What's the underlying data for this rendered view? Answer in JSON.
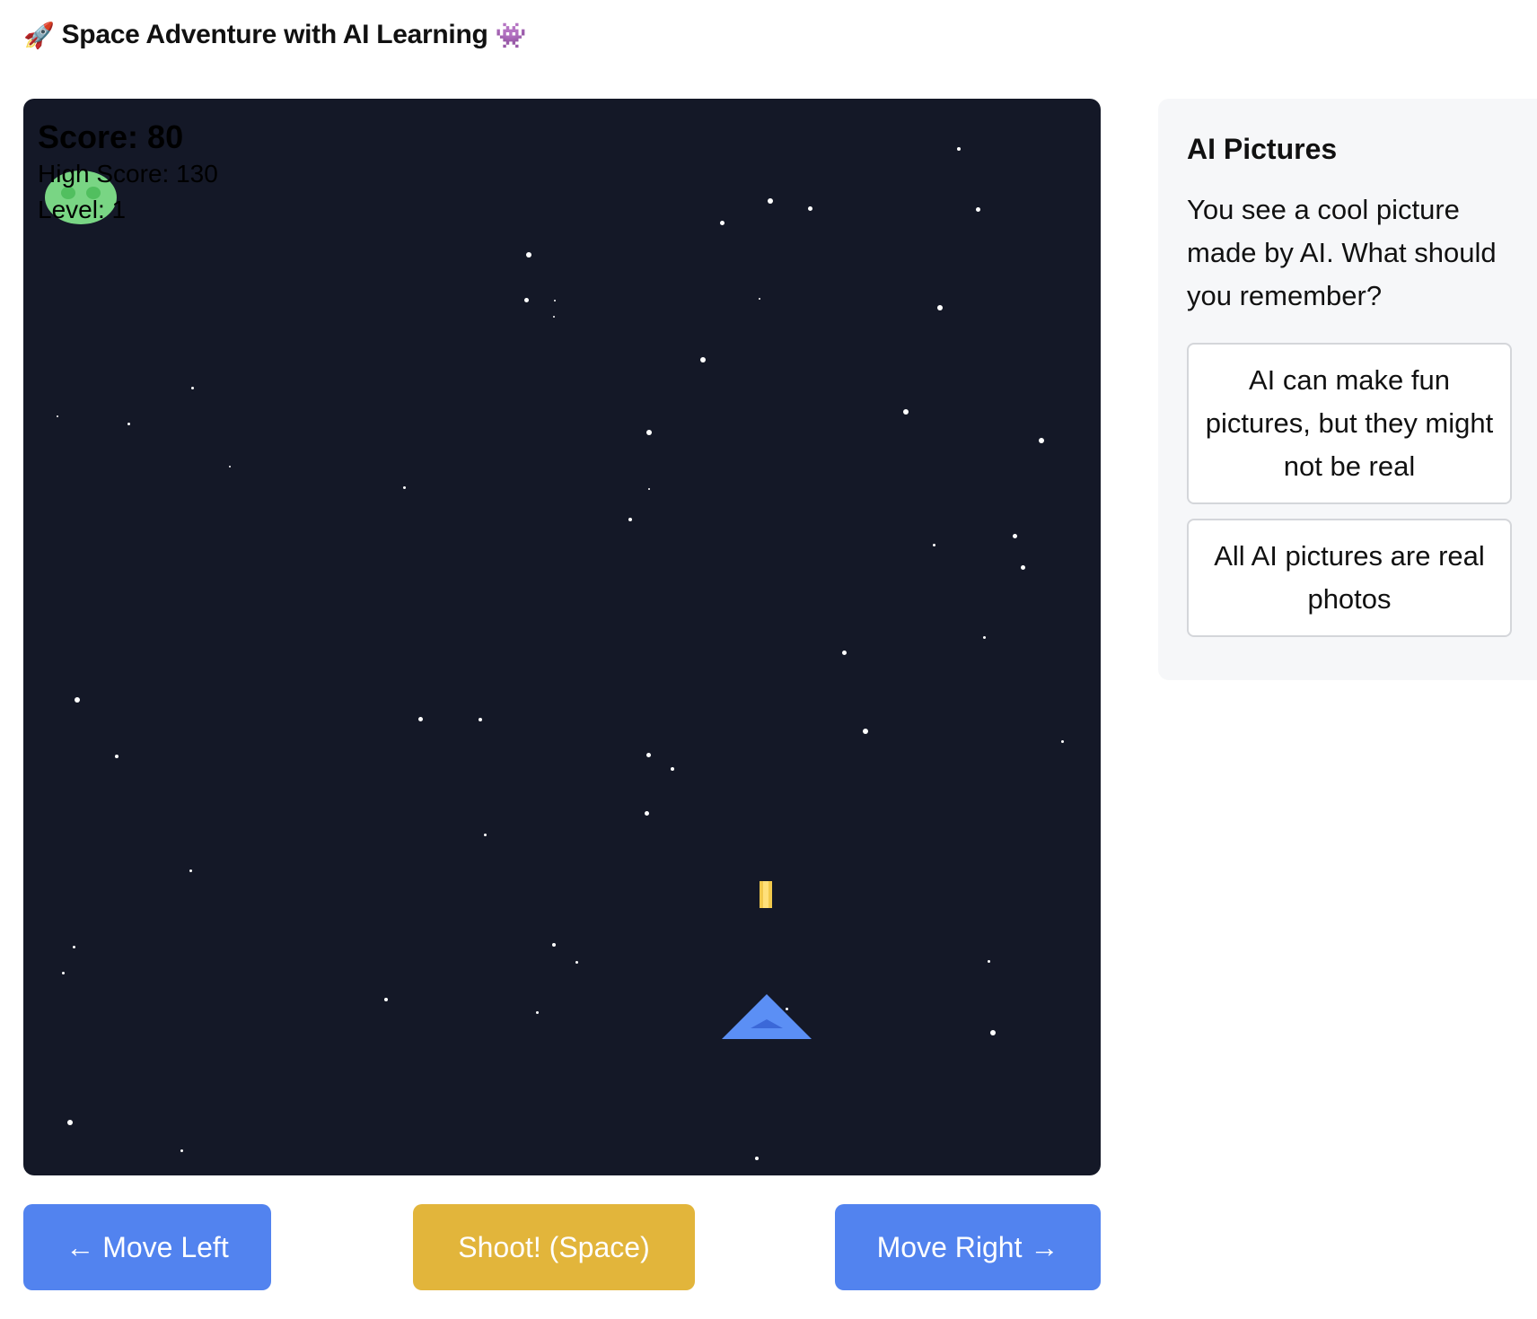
{
  "header": {
    "title": "Space Adventure with AI Learning",
    "left_emoji": "🚀",
    "right_emoji": "👾"
  },
  "game": {
    "hud": {
      "score": "Score: 80",
      "high_score": "High Score: 130",
      "level": "Level: 1"
    },
    "colors": {
      "background": "#141827",
      "enemy": "#7fe08a",
      "ship": "#5b8ff5",
      "bullet": "#f2c94c"
    },
    "sprites": {
      "enemy": "green-alien-icon",
      "ship": "blue-triangle-ship-icon",
      "bullet": "yellow-laser-bullet"
    }
  },
  "controls": {
    "move_left": "← Move Left",
    "shoot": "Shoot! (Space)",
    "move_right": "Move Right →"
  },
  "quiz": {
    "title": "AI Pictures",
    "question": "You see a cool picture made by AI. What should you remember?",
    "options": [
      "AI can make fun pictures, but they might not be real",
      "All AI pictures are real photos"
    ]
  }
}
